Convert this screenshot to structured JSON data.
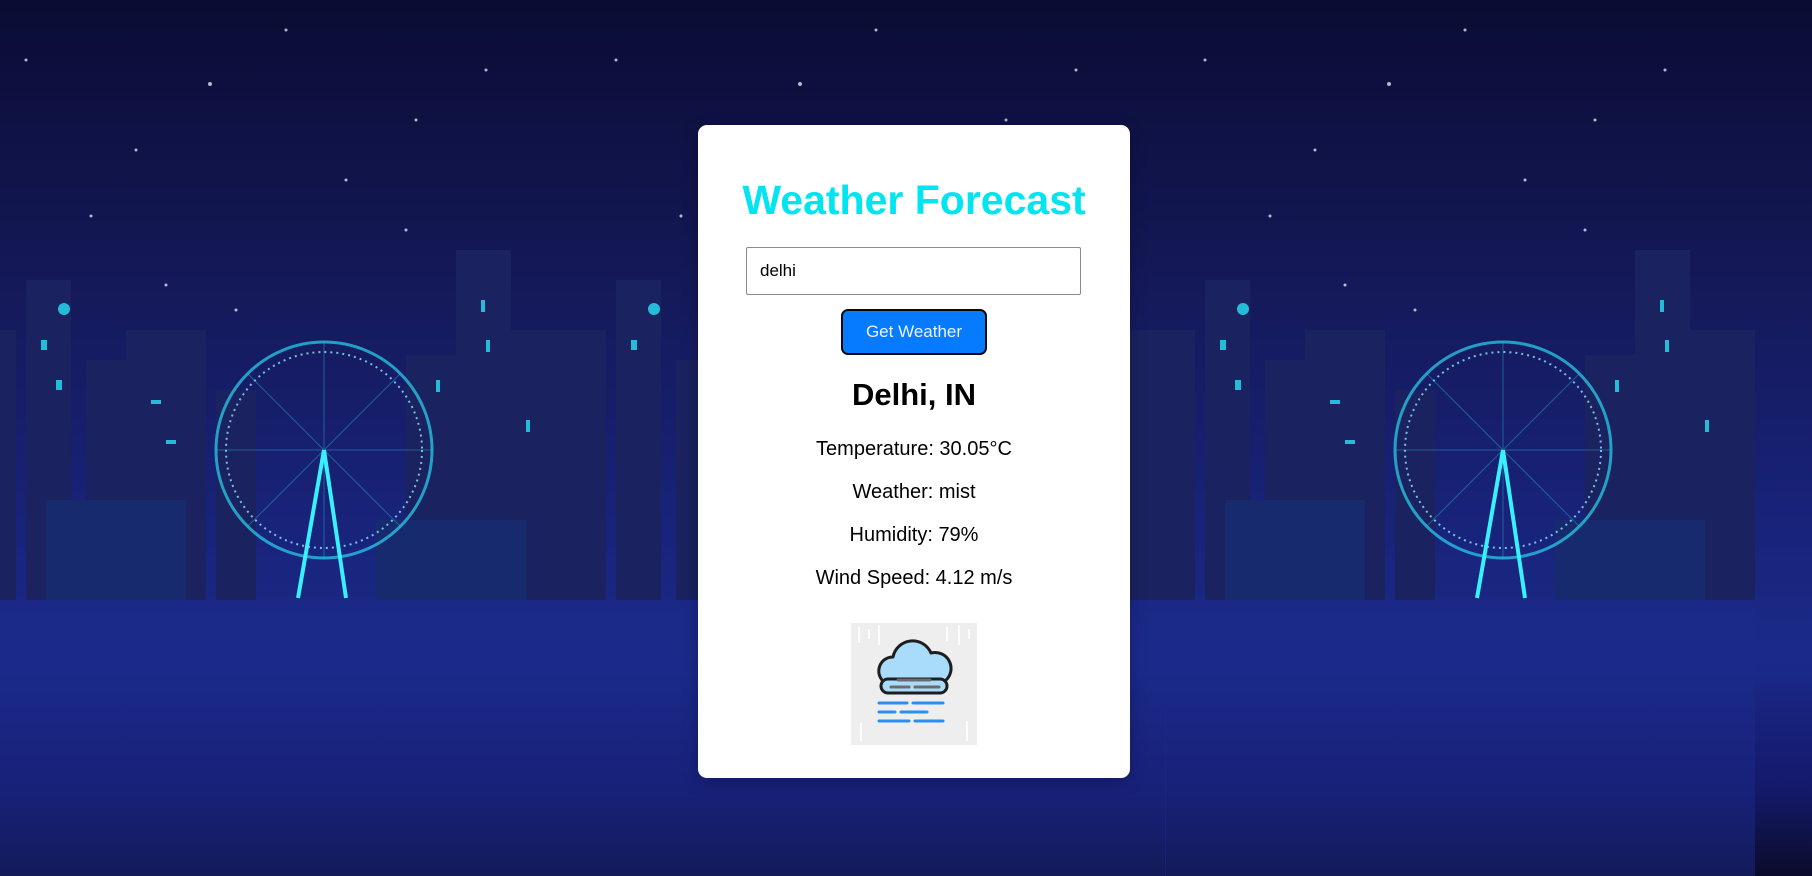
{
  "app": {
    "title": "Weather Forecast"
  },
  "search": {
    "value": "delhi",
    "button_label": "Get Weather"
  },
  "result": {
    "location": "Delhi, IN",
    "temperature": "Temperature: 30.05°C",
    "weather": "Weather: mist",
    "humidity": "Humidity: 79%",
    "wind_speed": "Wind Speed: 4.12 m/s"
  },
  "icons": {
    "weather_icon": "mist-cloud-icon"
  },
  "colors": {
    "title": "#00e5f0",
    "button": "#077bff",
    "card": "#ffffff",
    "background": "#151a5c"
  }
}
